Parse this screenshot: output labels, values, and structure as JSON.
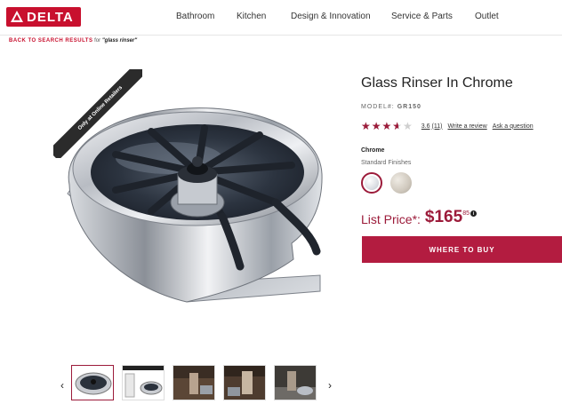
{
  "header": {
    "logo": {
      "text": "DELTA",
      "color": "#c8102e",
      "icon": "delta-triangle-icon"
    },
    "nav": [
      "Bathroom",
      "Kitchen",
      "Design & Innovation",
      "Service & Parts",
      "Outlet"
    ]
  },
  "breadcrumb": {
    "link": "BACK TO SEARCH RESULTS",
    "for_text": "for",
    "query": "\"glass rinser\""
  },
  "gallery": {
    "ribbon": "Only at Online Retailers",
    "prev_icon": "chevron-left-icon",
    "next_icon": "chevron-right-icon",
    "thumbnail_count": 5
  },
  "product": {
    "title": "Glass Rinser In Chrome",
    "model_label": "MODEL#:",
    "model_value": "GR150",
    "rating": {
      "stars": 3.6,
      "max": 5,
      "value_text": "3.6",
      "count_text": "(11)",
      "write_review": "Write a review",
      "ask_question": "Ask a question",
      "star_color": "#9c1b3a"
    },
    "finish": {
      "selected": "Chrome",
      "group_label": "Standard Finishes",
      "swatches": [
        "Chrome",
        "Nickel"
      ]
    },
    "price": {
      "label": "List Price",
      "asterisk": "*",
      "colon": ":",
      "dollars": "$165",
      "cents": "85",
      "info_icon": "info-icon"
    },
    "cta": "WHERE TO BUY",
    "accent_color": "#b31c40"
  }
}
